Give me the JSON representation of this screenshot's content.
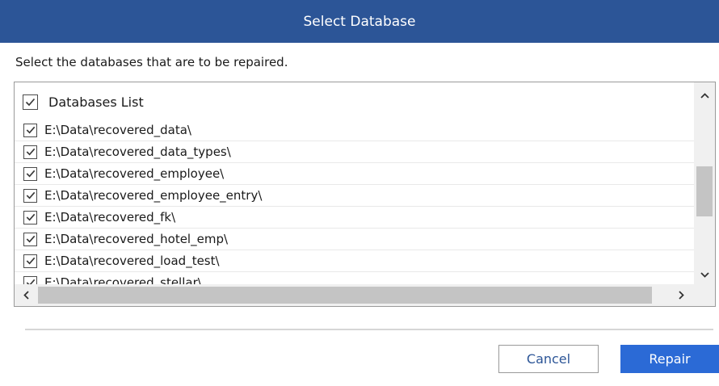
{
  "dialog": {
    "title": "Select Database",
    "instruction": "Select the databases that are to be repaired."
  },
  "list": {
    "header_label": "Databases List",
    "header_checked": true,
    "items": [
      {
        "label": "E:\\Data\\recovered_data\\",
        "checked": true
      },
      {
        "label": "E:\\Data\\recovered_data_types\\",
        "checked": true
      },
      {
        "label": "E:\\Data\\recovered_employee\\",
        "checked": true
      },
      {
        "label": "E:\\Data\\recovered_employee_entry\\",
        "checked": true
      },
      {
        "label": "E:\\Data\\recovered_fk\\",
        "checked": true
      },
      {
        "label": "E:\\Data\\recovered_hotel_emp\\",
        "checked": true
      },
      {
        "label": "E:\\Data\\recovered_load_test\\",
        "checked": true
      },
      {
        "label": "E:\\Data\\recovered_stellar\\",
        "checked": true
      }
    ]
  },
  "buttons": {
    "cancel_label": "Cancel",
    "repair_label": "Repair"
  },
  "colors": {
    "title_bar": "#2c5597",
    "primary_button": "#2b6ad6",
    "secondary_text": "#2c5597"
  },
  "icons": {
    "check": "checkmark-icon",
    "scroll_up": "chevron-up-icon",
    "scroll_down": "chevron-down-icon",
    "scroll_left": "chevron-left-icon",
    "scroll_right": "chevron-right-icon"
  }
}
